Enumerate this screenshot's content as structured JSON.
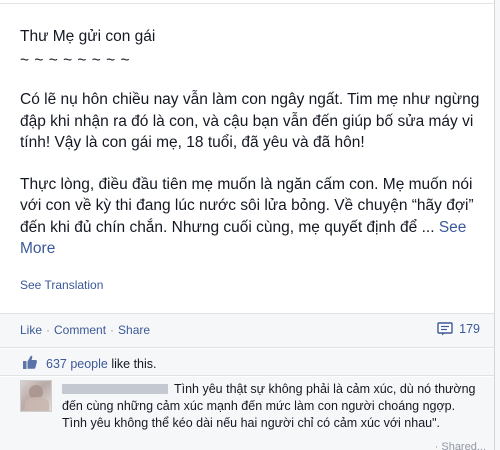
{
  "post": {
    "title": "Thư Mẹ gửi con gái",
    "wave": "~ ~ ~ ~ ~ ~ ~ ~",
    "para1": "Có lẽ nụ hôn chiều nay vẫn làm con ngây ngất. Tim mẹ như ngừng đập khi nhận ra đó là con, và cậu bạn vẫn đến giúp bố sửa máy vi tính! Vậy là con gái mẹ, 18 tuổi, đã yêu và đã hôn!",
    "para2": "Thực lòng, điều đầu tiên mẹ muốn là ngăn cấm con. Mẹ muốn nói với con về kỳ thi đang lúc nước sôi lửa bỏng. Về chuyện “hãy đợi” đến khi đủ chín chắn. Nhưng cuối cùng, mẹ quyết định để ...",
    "see_more": "See More",
    "see_translation": "See Translation"
  },
  "actions": {
    "like": "Like",
    "separator": "·",
    "comment": "Comment",
    "share": "Share",
    "comment_count": "179",
    "comment_icon": "comment-bubble-icon"
  },
  "likes": {
    "thumb_icon": "thumbs-up-icon",
    "people": "637 people",
    "suffix": "like this."
  },
  "comment": {
    "text": "Tình yêu thật sự không phải là cảm xúc, dù nó thường đến cùng những cảm xúc mạnh đến mức làm con người choáng ngợp. Tình yêu không thể kéo dài nếu hai người chỉ có cảm xúc với nhau\".",
    "footer": "· Shared..."
  },
  "colors": {
    "link": "#3b5998",
    "text": "#141823",
    "panel_bg": "#f6f7f8",
    "border": "#e1e2e3"
  }
}
